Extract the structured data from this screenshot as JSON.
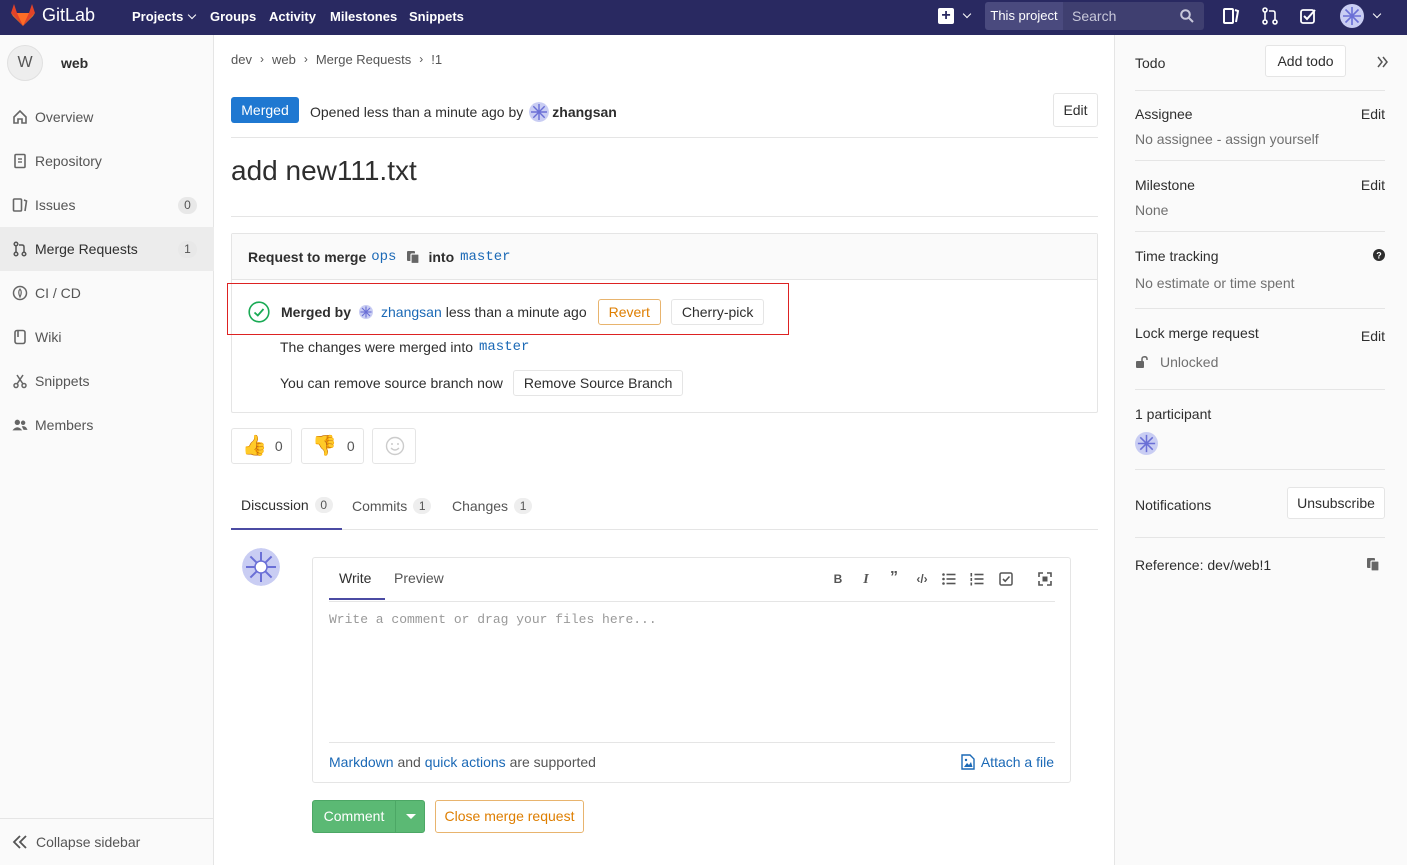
{
  "header": {
    "brand": "GitLab",
    "nav": [
      "Projects",
      "Groups",
      "Activity",
      "Milestones",
      "Snippets"
    ],
    "scope": "This project",
    "search_placeholder": "Search"
  },
  "sidebar": {
    "project_initial": "W",
    "project_name": "web",
    "items": [
      {
        "label": "Overview",
        "icon": "home-icon"
      },
      {
        "label": "Repository",
        "icon": "book-icon"
      },
      {
        "label": "Issues",
        "icon": "issues-icon",
        "count": "0"
      },
      {
        "label": "Merge Requests",
        "icon": "merge-request-icon",
        "count": "1"
      },
      {
        "label": "CI / CD",
        "icon": "rocket-icon"
      },
      {
        "label": "Wiki",
        "icon": "wiki-icon"
      },
      {
        "label": "Snippets",
        "icon": "scissors-icon"
      },
      {
        "label": "Members",
        "icon": "users-icon"
      }
    ],
    "collapse_label": "Collapse sidebar"
  },
  "breadcrumb": [
    "dev",
    "web",
    "Merge Requests",
    "!1"
  ],
  "mr": {
    "status": "Merged",
    "opened_text": "Opened less than a minute ago by",
    "author": "zhangsan",
    "edit_label": "Edit",
    "title": "add new111.txt",
    "request_prefix": "Request to merge",
    "source_branch": "ops",
    "into": "into",
    "target_branch": "master",
    "merged_by_label": "Merged by",
    "merged_by_user": "zhangsan",
    "merged_time": "less than a minute ago",
    "revert_label": "Revert",
    "cherry_pick_label": "Cherry-pick",
    "merged_into_text": "The changes were merged into",
    "remove_branch_text": "You can remove source branch now",
    "remove_branch_button": "Remove Source Branch"
  },
  "awards": {
    "thumbsup_count": "0",
    "thumbsdown_count": "0"
  },
  "tabs": [
    {
      "label": "Discussion",
      "count": "0"
    },
    {
      "label": "Commits",
      "count": "1"
    },
    {
      "label": "Changes",
      "count": "1"
    }
  ],
  "editor": {
    "write_tab": "Write",
    "preview_tab": "Preview",
    "placeholder": "Write a comment or drag your files here...",
    "footer_markdown": "Markdown",
    "footer_and": "and",
    "footer_quick_actions": "quick actions",
    "footer_supported": "are supported",
    "attach_label": "Attach a file"
  },
  "actions": {
    "comment_label": "Comment",
    "close_label": "Close merge request"
  },
  "right_sidebar": {
    "todo_label": "Todo",
    "add_todo": "Add todo",
    "assignee_title": "Assignee",
    "assignee_value": "No assignee - assign yourself",
    "milestone_title": "Milestone",
    "milestone_value": "None",
    "time_title": "Time tracking",
    "time_value": "No estimate or time spent",
    "lock_title": "Lock merge request",
    "lock_value": "Unlocked",
    "participants_title": "1 participant",
    "notifications_title": "Notifications",
    "unsubscribe": "Unsubscribe",
    "reference": "Reference: dev/web!1",
    "edit_label": "Edit"
  },
  "colors": {
    "header_bg": "#292961",
    "merged_badge": "#1f78d1",
    "comment_button": "#5bb974",
    "warning": "#de7e00",
    "link": "#1b69b6"
  }
}
